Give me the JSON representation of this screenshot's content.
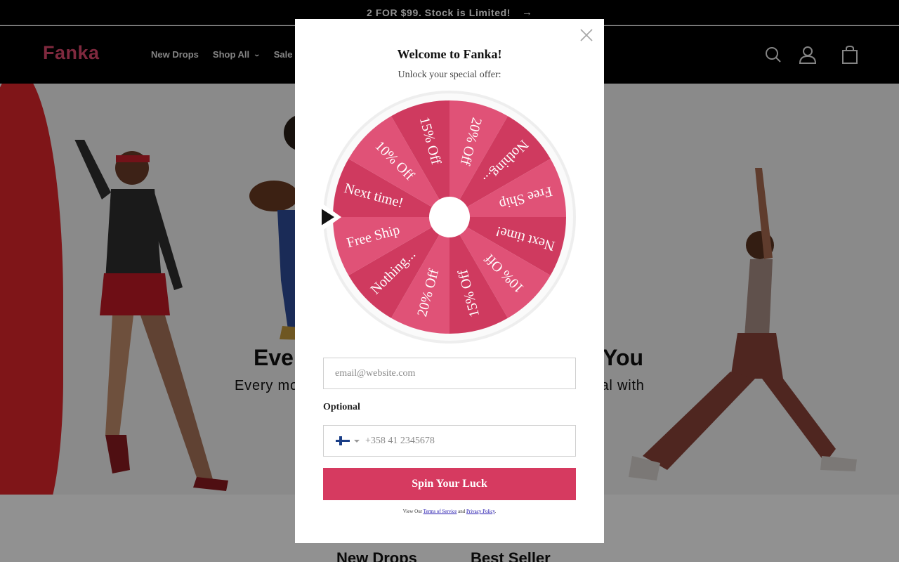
{
  "announcement": {
    "text": "2 FOR $99. Stock is Limited!",
    "arrow": "→"
  },
  "header": {
    "logo": "Fanka",
    "nav": [
      {
        "label": "New Drops"
      },
      {
        "label": "Shop All",
        "chevron": "⌄"
      },
      {
        "label": "Sale"
      }
    ],
    "icons": [
      "search-icon",
      "account-icon",
      "cart-icon"
    ]
  },
  "hero": {
    "title_left": "Eve",
    "title_right": "You",
    "subtitle_left": "Every mo",
    "subtitle_right": "ential with"
  },
  "sections": {
    "tab1": "New Drops",
    "tab2": "Best Seller"
  },
  "modal": {
    "title": "Welcome to Fanka!",
    "subtitle": "Unlock your special offer:",
    "wheel_segments": [
      "20% Off",
      "Nothing...",
      "Free Ship",
      "Next time!",
      "10% Off",
      "15% Off",
      "20% Off",
      "Nothing...",
      "Free Ship",
      "Next time!",
      "10% Off",
      "15% Off"
    ],
    "email_placeholder": "email@website.com",
    "optional_label": "Optional",
    "phone_placeholder": "+358 41 2345678",
    "spin_button": "Spin Your Luck",
    "terms_prefix": "View Our",
    "terms_link": "Terms of Service",
    "terms_and": "and",
    "privacy_link": "Privacy Policy",
    "terms_suffix": "."
  },
  "colors": {
    "brand": "#e0486d",
    "button": "#d63a60",
    "wheel_light": "#e05277",
    "wheel_dark": "#cf3a5f"
  }
}
